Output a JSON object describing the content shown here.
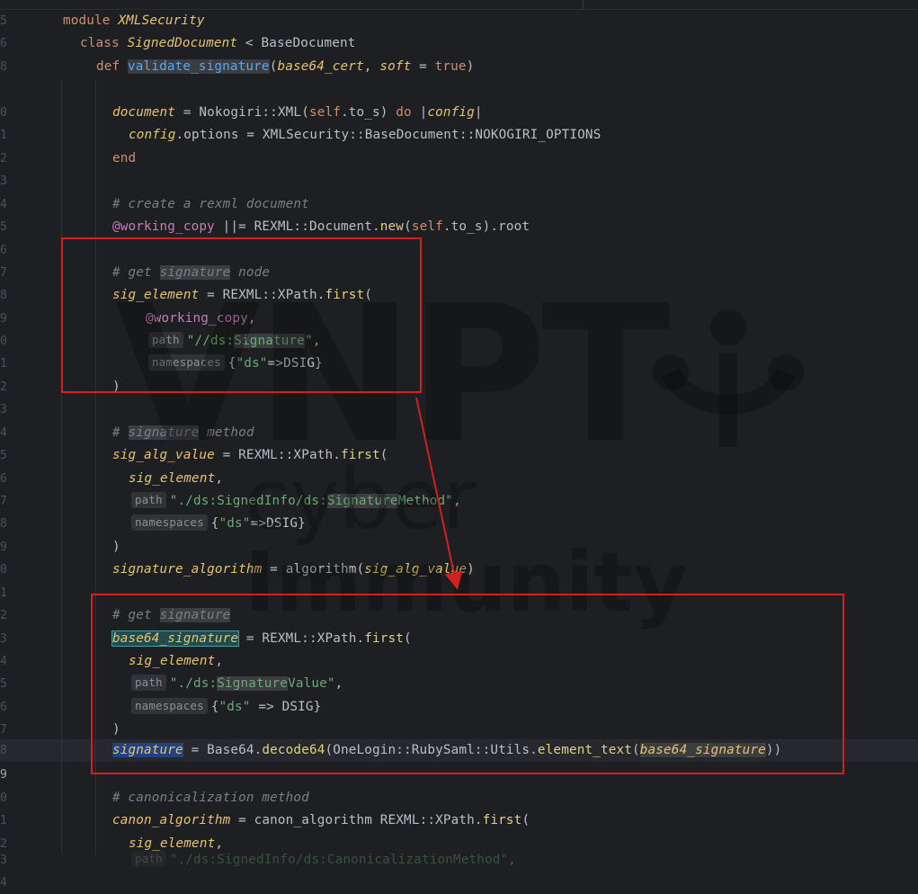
{
  "gutter": {
    "numbers": [
      "5",
      "6",
      "8",
      "0",
      "1",
      "2",
      "3",
      "4",
      "5",
      "6",
      "7",
      "8",
      "9",
      "0",
      "1",
      "2",
      "3",
      "4",
      "5",
      "6",
      "7",
      "8",
      "9",
      "0",
      "1",
      "2",
      "3",
      "4",
      "5",
      "6",
      "7",
      "8",
      "9",
      "0",
      "1",
      "2",
      "3",
      "4"
    ],
    "current_index": 32
  },
  "code": {
    "module_kw": "module",
    "module_name": "XMLSecurity",
    "class_kw": "class",
    "class_name": "SignedDocument",
    "class_lt": " < ",
    "class_base": "BaseDocument",
    "def_kw": "def",
    "def_name": "validate_signature",
    "def_params": {
      "open": "(",
      "p1": "base64_cert",
      "comma": ", ",
      "p2": "soft",
      "eq": " = ",
      "true_kw": "true",
      "close": ")"
    },
    "l_document": {
      "var": "document",
      "eq": " = ",
      "call": "Nokogiri::XML(",
      "self_kw": "self",
      "to_s": ".to_s) ",
      "do_kw": "do",
      "pipe_open": " |",
      "block_var": "config",
      "pipe_close": "|"
    },
    "l_config": {
      "var": "config",
      "rest": ".options = XMLSecurity::BaseDocument::NOKOGIRI_OPTIONS"
    },
    "end_kw": "end",
    "c_rexml": "# create a rexml document",
    "l_working": {
      "ivar": "@working_copy",
      "op": " ||= REXML::Document.",
      "new_fn": "new",
      "paren": "(",
      "self_kw": "self",
      "rest": ".to_s).root"
    },
    "c_sig_node": {
      "pre": "# get ",
      "hl": "signature",
      "post": " node"
    },
    "l_sig_element": {
      "var": "sig_element",
      "eq": " = REXML::XPath.",
      "fn": "first",
      "paren": "("
    },
    "l_arg_working": {
      "ivar": "@working_copy",
      "comma": ","
    },
    "l_arg_path1": {
      "hint": "path",
      "str_pre": "\"//ds:",
      "str_hl": "Signature",
      "str_post": "\"",
      "comma": ","
    },
    "l_arg_ns1": {
      "hint": "namespaces",
      "brace": "{",
      "str": "\"ds\"",
      "rest": "=>DSIG}"
    },
    "close_paren": ")",
    "c_sig_method": {
      "pre": "# ",
      "hl": "signature",
      "post": " method"
    },
    "l_sig_alg": {
      "var": "sig_alg_value",
      "eq": " = REXML::XPath.",
      "fn": "first",
      "paren": "("
    },
    "l_arg_sigel": {
      "var": "sig_element",
      "comma": ","
    },
    "l_arg_path2": {
      "hint": "path",
      "str_pre": "\"./ds:SignedInfo/ds:",
      "str_hl": "Signature",
      "str_post": "Method\"",
      "comma": ","
    },
    "l_arg_ns2": {
      "hint": "namespaces",
      "brace": "{",
      "str": "\"ds\"",
      "rest": "=>DSIG}"
    },
    "l_sig_algorithm": {
      "var": "signature_algorithm",
      "eq": " = ",
      "fn": "algorithm",
      "paren": "(",
      "arg": "sig_alg_value",
      "close": ")"
    },
    "c_get_sig": {
      "pre": "# get ",
      "hl": "signature"
    },
    "l_b64sig": {
      "var": "base64_signature",
      "eq": " = REXML::XPath.",
      "fn": "first",
      "paren": "("
    },
    "l_arg_path3": {
      "hint": "path",
      "str_pre": "\"./ds:",
      "str_hl": "Signature",
      "str_post": "Value\"",
      "comma": ","
    },
    "l_arg_ns3": {
      "hint": "namespaces",
      "brace": "{",
      "str": "\"ds\"",
      "rest": " => DSIG}"
    },
    "l_signature": {
      "var": "signature",
      "eq": " = Base64.",
      "fn": "decode64",
      "mid": "(OneLogin::RubySaml::Utils.",
      "fn2": "element_text",
      "paren": "(",
      "arg": "base64_signature",
      "close": "))"
    },
    "c_canon": "# canonicalization method",
    "l_canon": {
      "var": "canon_algorithm",
      "eq": " = ",
      "fn": "canon_algorithm",
      "mid": " REXML::XPath.",
      "fn2": "first",
      "paren": "("
    },
    "l_last": {
      "hint": "path",
      "str": "\"./ds:SignedInfo/ds:CanonicalizationMethod\"",
      "comma": ","
    }
  },
  "watermark": {
    "brand": "VNPT",
    "cyber": "cyber",
    "immunity": "Immunity"
  },
  "annotation_color": "#d21f1f"
}
